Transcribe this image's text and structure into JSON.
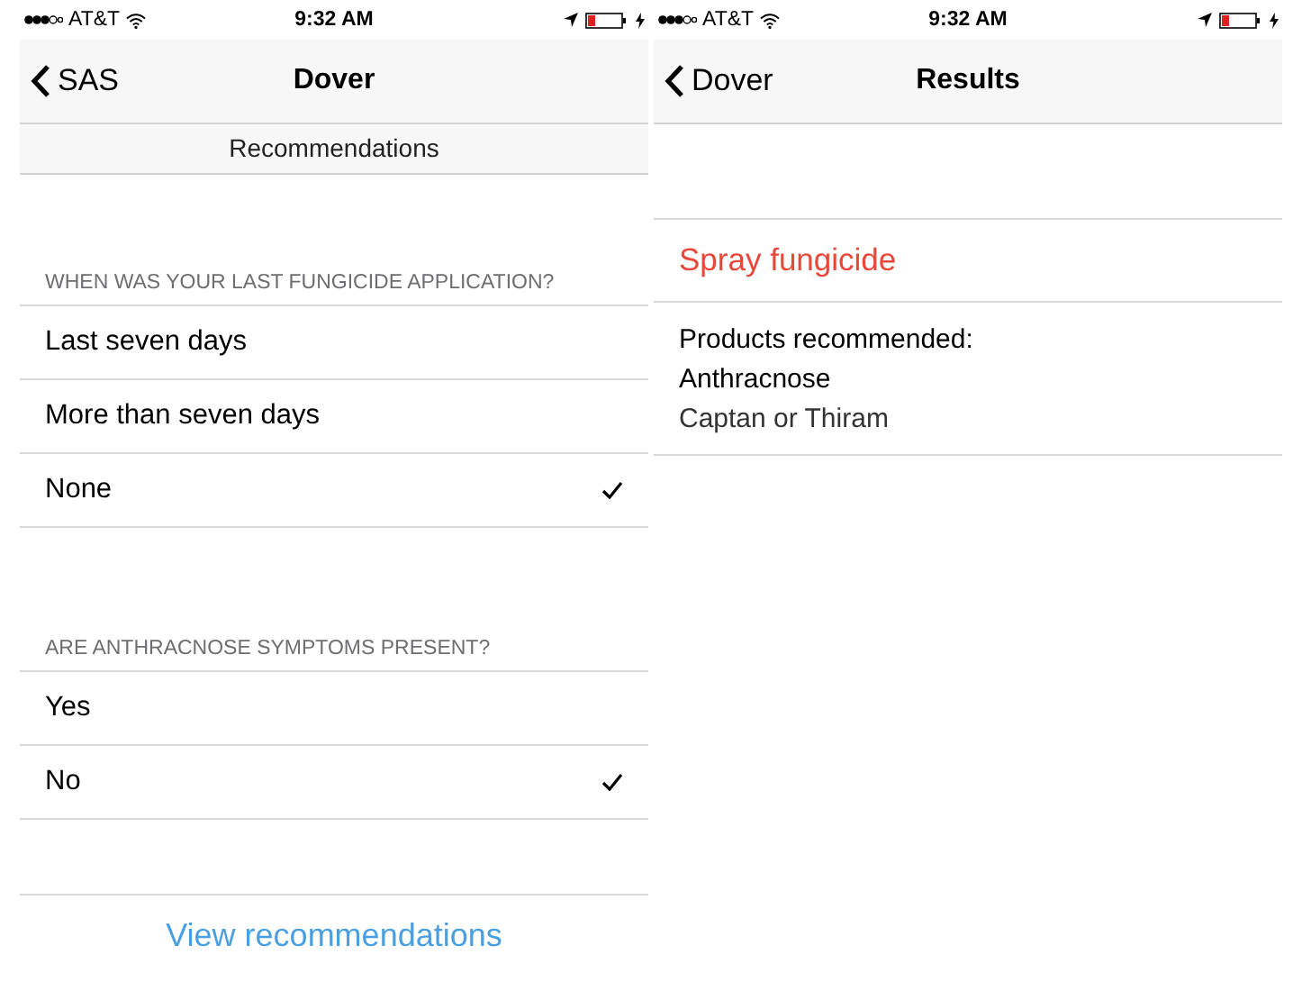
{
  "recommendations_screen": {
    "status_bar": {
      "carrier": "AT&T",
      "time": "9:32 AM"
    },
    "nav": {
      "back": "SAS",
      "title": "Dover"
    },
    "subheader": "Recommendations",
    "sections": [
      {
        "header": "WHEN WAS YOUR LAST FUNGICIDE APPLICATION?",
        "options": [
          {
            "label": "Last seven days",
            "selected": false
          },
          {
            "label": "More than seven days",
            "selected": false
          },
          {
            "label": "None",
            "selected": true
          }
        ]
      },
      {
        "header": "ARE ANTHRACNOSE SYMPTOMS PRESENT?",
        "options": [
          {
            "label": "Yes",
            "selected": false
          },
          {
            "label": "No",
            "selected": true
          }
        ]
      }
    ],
    "action": "View recommendations"
  },
  "results_screen": {
    "status_bar": {
      "carrier": "AT&T",
      "time": "9:32 AM"
    },
    "nav": {
      "back": "Dover",
      "title": "Results"
    },
    "result": "Spray fungicide",
    "products_label": "Products recommended:",
    "disease": "Anthracnose",
    "products": "Captan or Thiram"
  }
}
